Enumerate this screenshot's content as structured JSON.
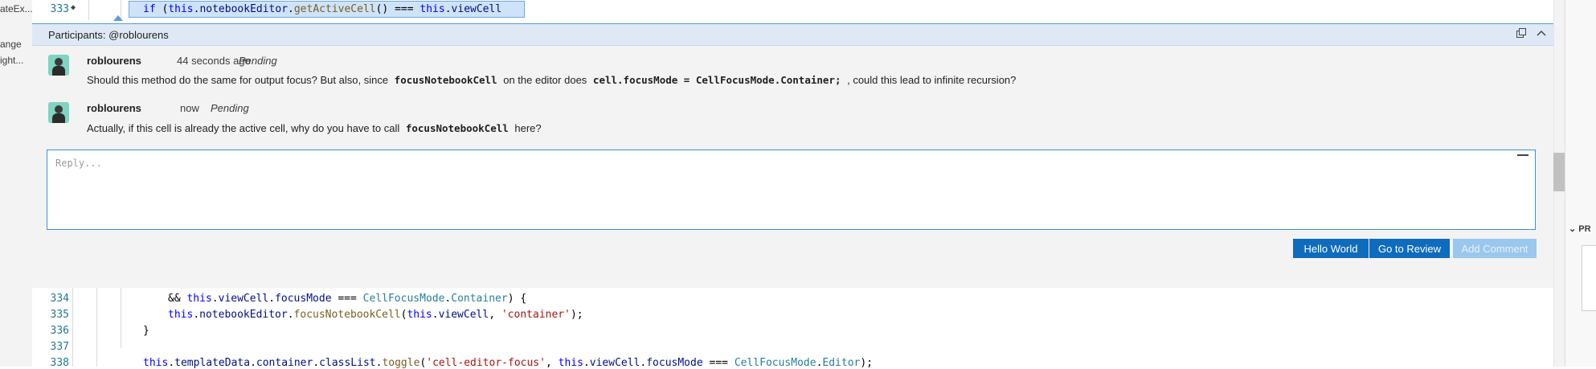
{
  "left_sidebar": {
    "fragments": [
      "ateEx...",
      "ange",
      "ight..."
    ]
  },
  "top_line": {
    "line_number": "333",
    "fold_glyph": "◆",
    "code": {
      "if_kw": "if",
      "paren_open": " (",
      "this1": "this",
      "dot1": ".",
      "notebookEditor": "notebookEditor",
      "dot2": ".",
      "getActiveCell": "getActiveCell",
      "call": "()",
      "op": " === ",
      "this2": "this",
      "dot3": ".",
      "viewCell": "viewCell"
    }
  },
  "widget": {
    "participants": "Participants: @roblourens",
    "comments": [
      {
        "author": "roblourens",
        "time": "44 seconds ago",
        "status": "Pending",
        "text_parts": [
          "Should this method do the same for output focus? But also, since ",
          "focusNotebookCell",
          " on the editor does ",
          "cell.focusMode = CellFocusMode.Container;",
          " , could this lead to infinite recursion?"
        ]
      },
      {
        "author": "roblourens",
        "time": "now",
        "status": "Pending",
        "text_parts": [
          "Actually, if this cell is already the active cell, why do you have to call ",
          "focusNotebookCell",
          " here?"
        ]
      }
    ],
    "reply_placeholder": "Reply...",
    "buttons": {
      "hello_world": "Hello World",
      "go_to_review": "Go to Review",
      "add_comment": "Add Comment"
    }
  },
  "bottom_code": {
    "lines": [
      {
        "number": "334"
      },
      {
        "number": "335"
      },
      {
        "number": "336"
      },
      {
        "number": "337"
      },
      {
        "number": "338"
      }
    ],
    "l334": {
      "and": "&& ",
      "this": "this",
      "dot1": ".",
      "viewCell": "viewCell",
      "dot2": ".",
      "focusMode": "focusMode",
      "op": " === ",
      "CellFocusMode": "CellFocusMode",
      "dot3": ".",
      "Container": "Container",
      "end": ") {"
    },
    "l335": {
      "this1": "this",
      "dot1": ".",
      "notebookEditor": "notebookEditor",
      "dot2": ".",
      "focusNotebookCell": "focusNotebookCell",
      "open": "(",
      "this2": "this",
      "dot3": ".",
      "viewCell": "viewCell",
      "comma": ", ",
      "str": "'container'",
      "end": ");"
    },
    "l336": {
      "brace": "}"
    },
    "l338": {
      "this1": "this",
      "dot1": ".",
      "templateData": "templateData",
      "dot2": ".",
      "container": "container",
      "dot3": ".",
      "classList": "classList",
      "dot4": ".",
      "toggle": "toggle",
      "open": "(",
      "str": "'cell-editor-focus'",
      "comma": ", ",
      "this2": "this",
      "dot5": ".",
      "viewCell": "viewCell",
      "dot6": ".",
      "focusMode": "focusMode",
      "op": " === ",
      "CellFocusMode": "CellFocusMode",
      "dot7": ".",
      "Editor": "Editor",
      "end": ");"
    }
  },
  "right_panel": {
    "section_label": "PR"
  },
  "colors": {
    "accent": "#0f6cbd",
    "widget_border": "#5b9bd5",
    "keyword": "#0000ff",
    "property": "#001080",
    "type": "#267f99",
    "string": "#a31515"
  }
}
